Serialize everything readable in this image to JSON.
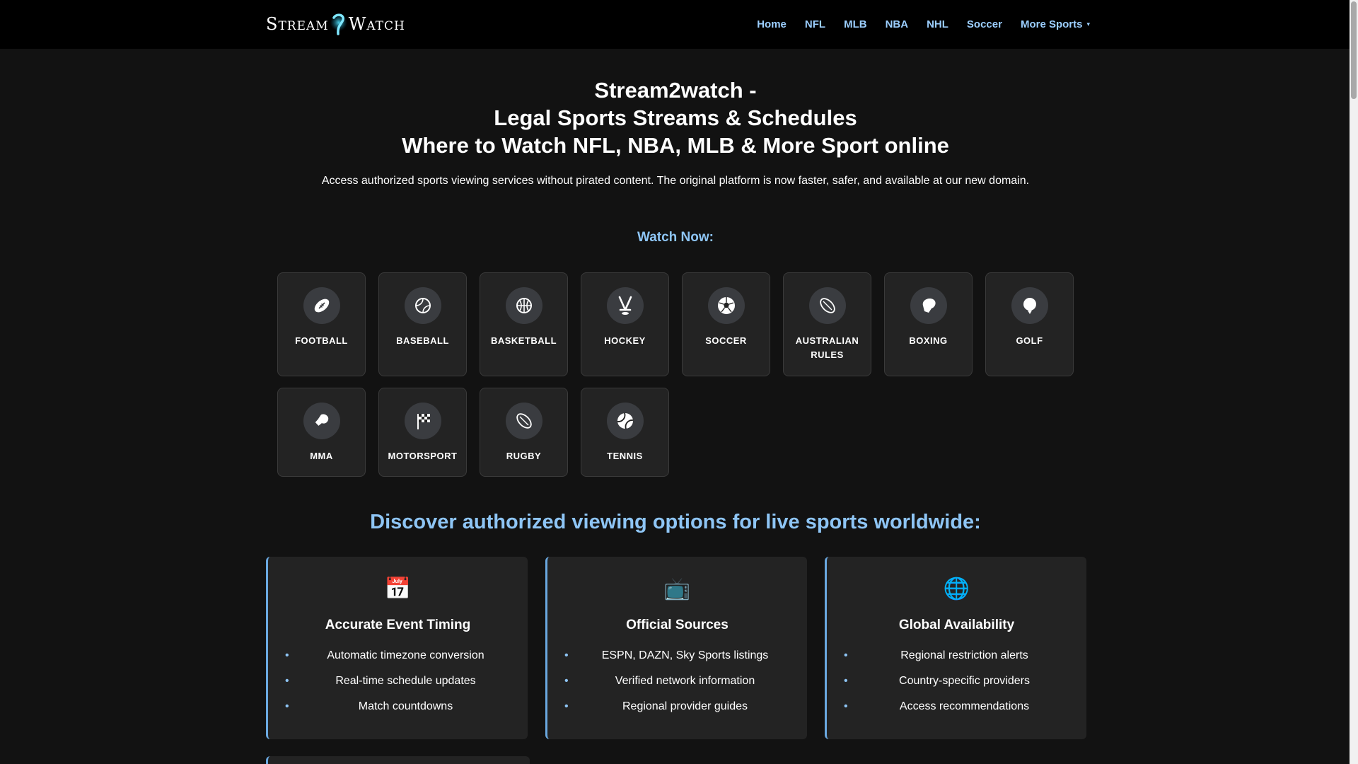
{
  "header": {
    "logo": {
      "left": "Stream",
      "right": "Watch",
      "icon": "stream2watch-logo-icon"
    },
    "nav": [
      {
        "label": "Home"
      },
      {
        "label": "NFL"
      },
      {
        "label": "MLB"
      },
      {
        "label": "NBA"
      },
      {
        "label": "NHL"
      },
      {
        "label": "Soccer"
      },
      {
        "label": "More Sports",
        "caret": "▾"
      }
    ]
  },
  "hero": {
    "title_lines": [
      "Stream2watch -",
      "Legal Sports Streams & Schedules",
      "Where to Watch NFL, NBA, MLB & More Sport online"
    ],
    "subtitle": "Access authorized sports viewing services without pirated content. The original platform is now faster, safer, and available at our new domain."
  },
  "watch_now": {
    "heading": "Watch Now:",
    "sports": [
      {
        "label": "FOOTBALL",
        "icon": "football-icon"
      },
      {
        "label": "BASEBALL",
        "icon": "baseball-icon"
      },
      {
        "label": "BASKETBALL",
        "icon": "basketball-icon"
      },
      {
        "label": "HOCKEY",
        "icon": "hockey-icon"
      },
      {
        "label": "SOCCER",
        "icon": "soccer-ball-icon"
      },
      {
        "label": "AUSTRALIAN RULES",
        "icon": "australian-rules-ball-icon"
      },
      {
        "label": "BOXING",
        "icon": "boxing-glove-icon"
      },
      {
        "label": "GOLF",
        "icon": "golf-ball-icon"
      },
      {
        "label": "MMA",
        "icon": "mma-glove-icon"
      },
      {
        "label": "MOTORSPORT",
        "icon": "checkered-flag-icon"
      },
      {
        "label": "RUGBY",
        "icon": "rugby-ball-icon"
      },
      {
        "label": "TENNIS",
        "icon": "tennis-ball-icon"
      }
    ]
  },
  "discover": {
    "heading": "Discover authorized viewing options for live sports worldwide:",
    "features": [
      {
        "icon": "calendar-icon",
        "glyph": "📅",
        "title": "Accurate Event Timing",
        "items": [
          "Automatic timezone conversion",
          "Real-time schedule updates",
          "Match countdowns"
        ]
      },
      {
        "icon": "television-icon",
        "glyph": "📺",
        "title": "Official Sources",
        "items": [
          "ESPN, DAZN, Sky Sports listings",
          "Verified network information",
          "Regional provider guides"
        ]
      },
      {
        "icon": "globe-icon",
        "glyph": "🌐",
        "title": "Global Availability",
        "items": [
          "Regional restriction alerts",
          "Country-specific providers",
          "Access recommendations"
        ]
      }
    ]
  },
  "colors": {
    "accent": "#8ec5f5",
    "nav_link": "#9ccfff",
    "background": "#121212",
    "card": "#232323"
  }
}
